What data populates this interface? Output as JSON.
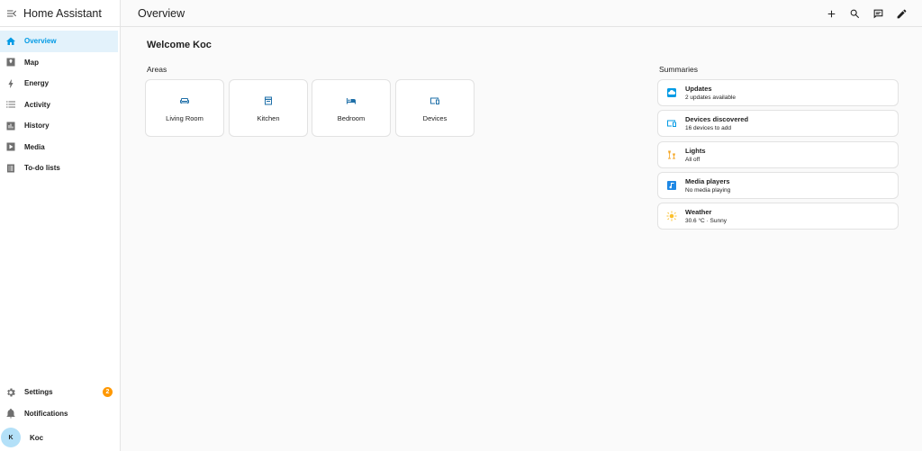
{
  "app": {
    "title": "Home Assistant"
  },
  "sidebar": {
    "items": [
      {
        "label": "Overview",
        "icon": "home-icon",
        "active": true
      },
      {
        "label": "Map",
        "icon": "map-icon"
      },
      {
        "label": "Energy",
        "icon": "lightning-icon"
      },
      {
        "label": "Activity",
        "icon": "list-icon"
      },
      {
        "label": "History",
        "icon": "chart-icon"
      },
      {
        "label": "Media",
        "icon": "play-box-icon"
      },
      {
        "label": "To-do lists",
        "icon": "clipboard-list-icon"
      }
    ],
    "bottom": {
      "settings_label": "Settings",
      "settings_badge": "2",
      "notifications_label": "Notifications",
      "user_initial": "K",
      "user_name": "Koc"
    }
  },
  "header": {
    "title": "Overview"
  },
  "main": {
    "welcome": "Welcome Koc",
    "areas_label": "Areas",
    "areas": [
      {
        "label": "Living Room",
        "icon": "sofa-icon"
      },
      {
        "label": "Kitchen",
        "icon": "stove-icon"
      },
      {
        "label": "Bedroom",
        "icon": "bed-icon"
      },
      {
        "label": "Devices",
        "icon": "devices-icon"
      }
    ],
    "summaries_label": "Summaries",
    "summaries": [
      {
        "title": "Updates",
        "subtitle": "2 updates available",
        "icon": "update-cloud-icon",
        "color": "#039be5"
      },
      {
        "title": "Devices discovered",
        "subtitle": "16 devices to add",
        "icon": "devices-icon",
        "color": "#039be5"
      },
      {
        "title": "Lights",
        "subtitle": "All off",
        "icon": "lamps-icon",
        "color": "#f5a623"
      },
      {
        "title": "Media players",
        "subtitle": "No media playing",
        "icon": "music-box-icon",
        "color": "#1e88e5"
      },
      {
        "title": "Weather",
        "subtitle": "30.6 °C · Sunny",
        "icon": "sun-icon",
        "color": "#fbc02d"
      }
    ]
  },
  "colors": {
    "accent": "#039be5",
    "badge": "#ff9800",
    "area_icon": "#1e6fa8"
  }
}
